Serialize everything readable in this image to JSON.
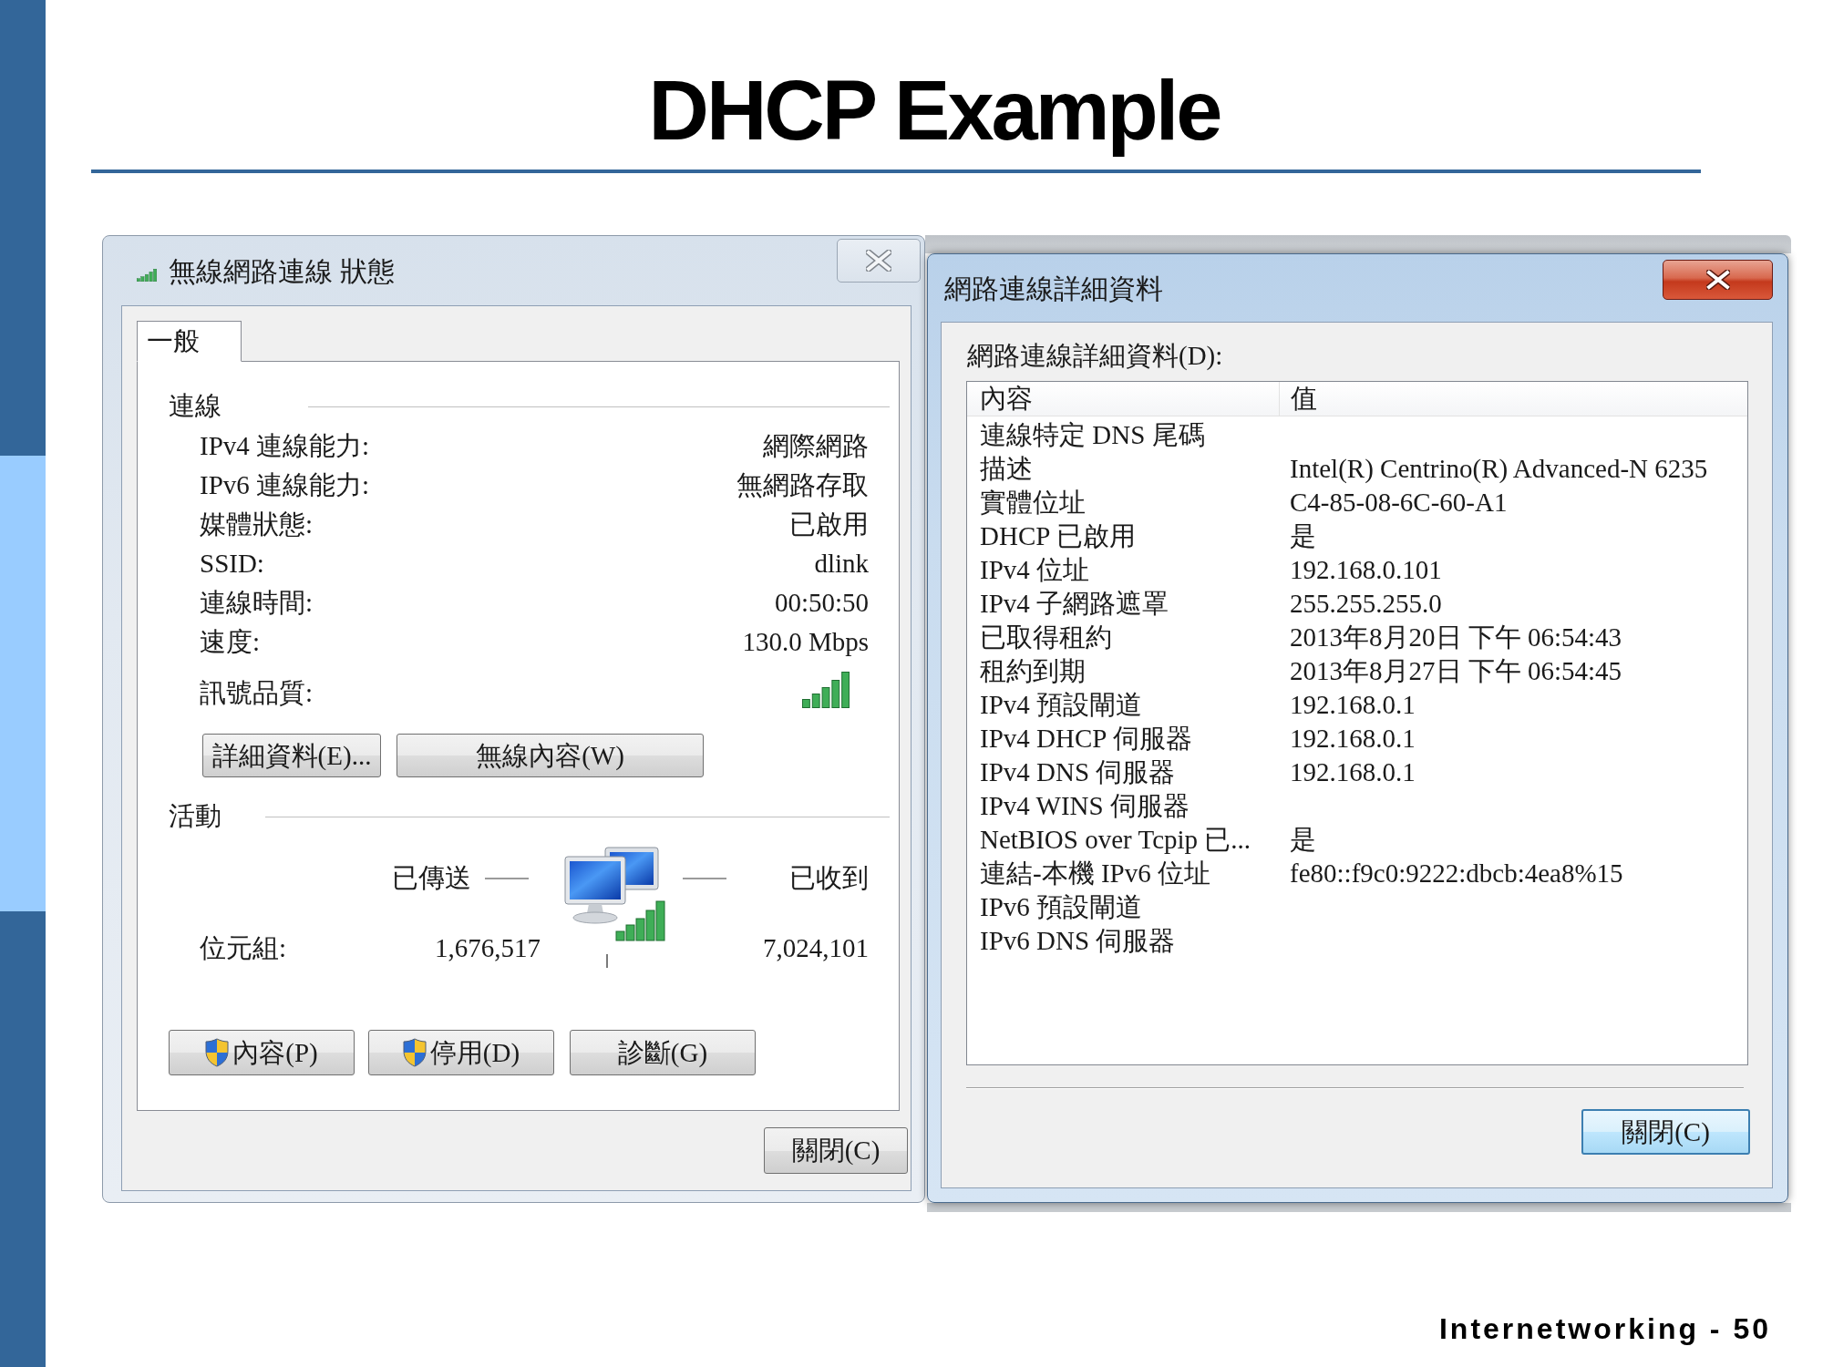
{
  "slide": {
    "title": "DHCP Example",
    "footer": "Internetworking - 50"
  },
  "status_window": {
    "active": false,
    "title": "無線網路連線 狀態",
    "tabs": [
      {
        "label": "一般",
        "selected": true
      }
    ],
    "connection": {
      "heading": "連線",
      "rows": [
        {
          "kind": "text",
          "label": "IPv4 連線能力:",
          "value": "網際網路"
        },
        {
          "kind": "text",
          "label": "IPv6 連線能力:",
          "value": "無網路存取"
        },
        {
          "kind": "text",
          "label": "媒體狀態:",
          "value": "已啟用"
        },
        {
          "kind": "text",
          "label": "SSID:",
          "value": "dlink"
        },
        {
          "kind": "text",
          "label": "連線時間:",
          "value": "00:50:50"
        },
        {
          "kind": "text",
          "label": "速度:",
          "value": "130.0 Mbps"
        },
        {
          "kind": "signal",
          "label": "訊號品質:"
        }
      ]
    },
    "connection_buttons": [
      "詳細資料(E)...",
      "無線內容(W)"
    ],
    "activity": {
      "heading": "活動",
      "sent_label": "已傳送",
      "received_label": "已收到",
      "bytes_label": "位元組:",
      "bytes_sent": "1,676,517",
      "bytes_received": "7,024,101"
    },
    "action_buttons": [
      {
        "label": "內容(P)",
        "shield": true
      },
      {
        "label": "停用(D)",
        "shield": true
      },
      {
        "label": "診斷(G)",
        "shield": false
      }
    ],
    "close_button": {
      "label": "關閉(C)",
      "focused": false
    }
  },
  "details_window": {
    "active": true,
    "title": "網路連線詳細資料",
    "list_label": "網路連線詳細資料(D):",
    "columns": [
      "內容",
      "值"
    ],
    "rows": [
      {
        "property": "連線特定 DNS 尾碼"
      },
      {
        "property": "描述",
        "value": "Intel(R) Centrino(R) Advanced-N 6235"
      },
      {
        "property": "實體位址",
        "value": "C4-85-08-6C-60-A1"
      },
      {
        "property": "DHCP 已啟用",
        "value": "是"
      },
      {
        "property": "IPv4 位址",
        "value": "192.168.0.101"
      },
      {
        "property": "IPv4 子網路遮罩",
        "value": "255.255.255.0"
      },
      {
        "property": "已取得租約",
        "value": "2013年8月20日 下午 06:54:43"
      },
      {
        "property": "租約到期",
        "value": "2013年8月27日 下午 06:54:45"
      },
      {
        "property": "IPv4 預設閘道",
        "value": "192.168.0.1"
      },
      {
        "property": "IPv4 DHCP 伺服器",
        "value": "192.168.0.1"
      },
      {
        "property": "IPv4 DNS 伺服器",
        "value": "192.168.0.1"
      },
      {
        "property": "IPv4 WINS 伺服器"
      },
      {
        "property": "NetBIOS over Tcpip 已...",
        "value": "是"
      },
      {
        "property": "連結-本機 IPv6 位址",
        "value": "fe80::f9c0:9222:dbcb:4ea8%15"
      },
      {
        "property": "IPv6 預設閘道"
      },
      {
        "property": "IPv6 DNS 伺服器"
      }
    ],
    "close_button": {
      "label": "關閉(C)",
      "focused": true
    }
  }
}
